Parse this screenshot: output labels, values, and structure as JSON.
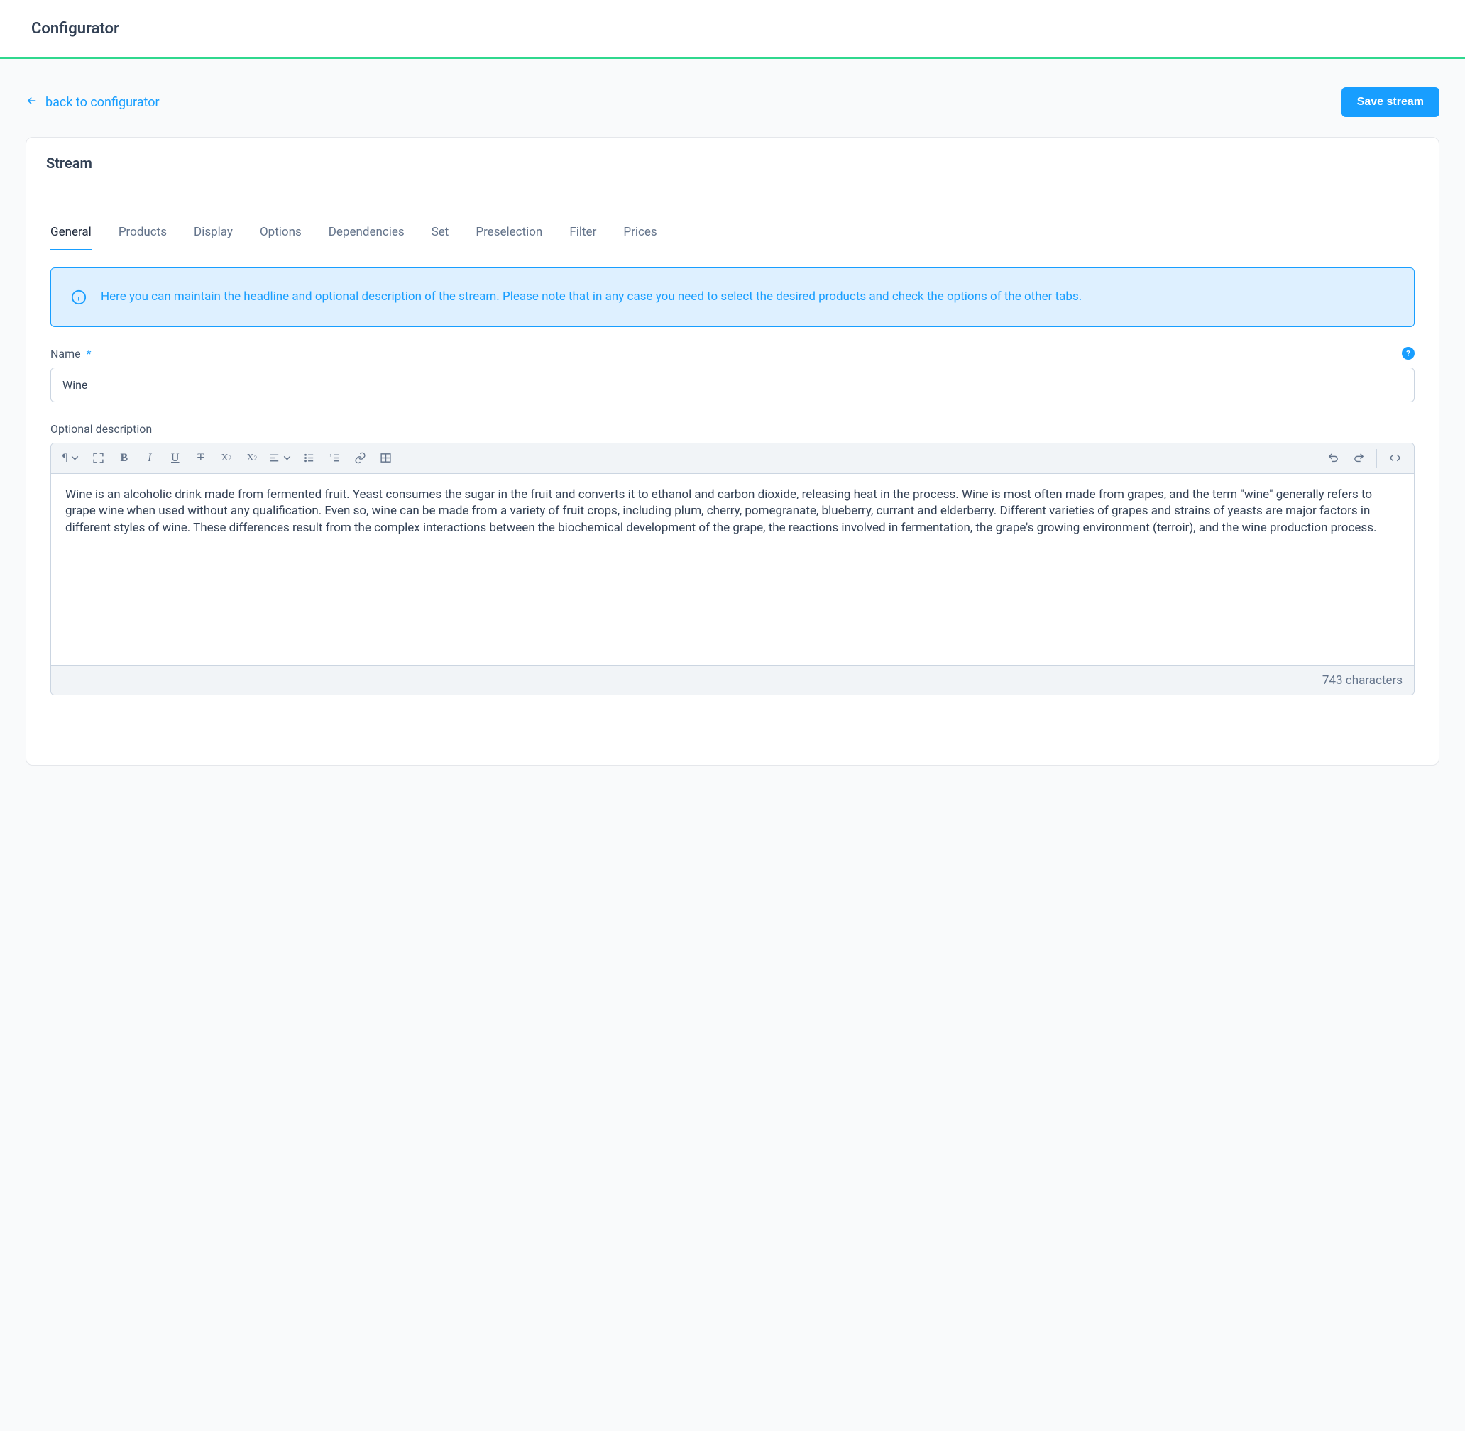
{
  "header": {
    "title": "Configurator"
  },
  "topbar": {
    "back_label": "back to configurator",
    "save_label": "Save stream"
  },
  "card": {
    "title": "Stream"
  },
  "tabs": [
    {
      "label": "General",
      "active": true
    },
    {
      "label": "Products",
      "active": false
    },
    {
      "label": "Display",
      "active": false
    },
    {
      "label": "Options",
      "active": false
    },
    {
      "label": "Dependencies",
      "active": false
    },
    {
      "label": "Set",
      "active": false
    },
    {
      "label": "Preselection",
      "active": false
    },
    {
      "label": "Filter",
      "active": false
    },
    {
      "label": "Prices",
      "active": false
    }
  ],
  "info": {
    "text": "Here you can maintain the headline and optional description of the stream. Please note that in any case you need to select the desired products and check the options of the other tabs."
  },
  "fields": {
    "name": {
      "label": "Name",
      "required_mark": "*",
      "value": "Wine",
      "help_glyph": "?"
    },
    "description": {
      "label": "Optional description",
      "value": "Wine is an alcoholic drink made from fermented fruit. Yeast consumes the sugar in the fruit and converts it to ethanol and carbon dioxide, releasing heat in the process. Wine is most often made from grapes, and the term \"wine\" generally refers to grape wine when used without any qualification. Even so, wine can be made from a variety of fruit crops, including plum, cherry, pomegranate, blueberry, currant and elderberry. Different varieties of grapes and strains of yeasts are major factors in different styles of wine. These differences result from the complex interactions between the biochemical development of the grape, the reactions involved in fermentation, the grape's growing environment (terroir), and the wine production process.",
      "char_count": "743 characters"
    }
  },
  "toolbar_icons": {
    "paragraph": "paragraph-icon",
    "fullscreen": "fullscreen-icon",
    "bold": "bold-icon",
    "italic": "italic-icon",
    "underline": "underline-icon",
    "strike": "strikethrough-icon",
    "superscript": "superscript-icon",
    "subscript": "subscript-icon",
    "align": "align-icon",
    "list_unordered": "list-unordered-icon",
    "list_ordered": "list-ordered-icon",
    "link": "link-icon",
    "table": "table-icon",
    "undo": "undo-icon",
    "redo": "redo-icon",
    "code": "code-view-icon"
  }
}
